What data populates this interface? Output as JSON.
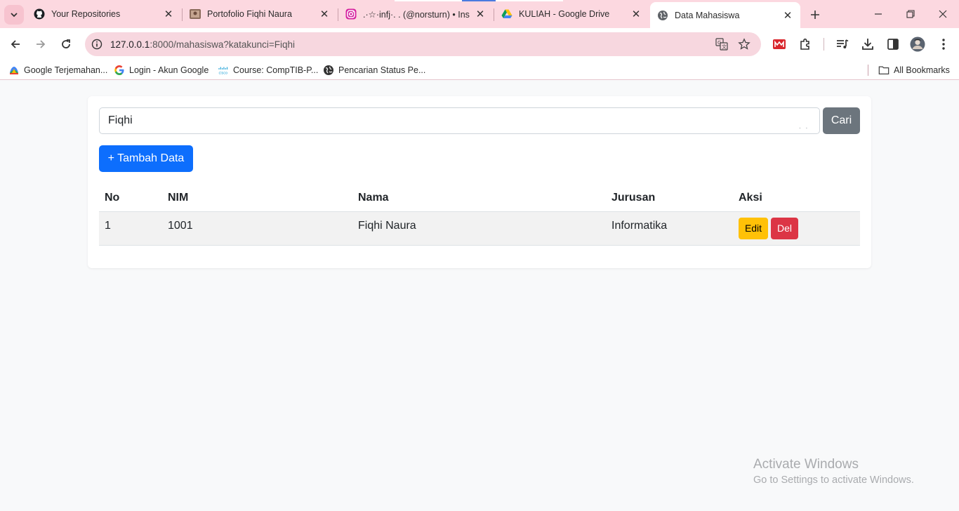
{
  "browser": {
    "tabs": [
      {
        "title": "Your Repositories",
        "icon": "github-icon"
      },
      {
        "title": "Portofolio Fiqhi Naura",
        "icon": "photo-favicon-icon"
      },
      {
        "title": ".·☆·infj·. . (@norsturn) • Ins",
        "icon": "instagram-icon"
      },
      {
        "title": "KULIAH - Google Drive",
        "icon": "google-drive-icon"
      },
      {
        "title": "Data Mahasiswa",
        "icon": "globe-icon",
        "active": true
      }
    ],
    "url_host": "127.0.0.1",
    "url_rest": ":8000/mahasiswa?katakunci=Fiqhi",
    "bookmarks": [
      {
        "label": "Google Terjemahan...",
        "icon": "translate-favicon-icon"
      },
      {
        "label": "Login - Akun Google",
        "icon": "google-icon"
      },
      {
        "label": "Course: CompTIB-P...",
        "icon": "cisco-icon"
      },
      {
        "label": "Pencarian Status Pe...",
        "icon": "globe-icon"
      }
    ],
    "all_bookmarks": "All Bookmarks",
    "colors": {
      "frame": "#fcd8e0",
      "omnibox": "#f7d7df"
    }
  },
  "page": {
    "search": {
      "value": "Fiqhi",
      "button_label": "Cari",
      "dots": ". ."
    },
    "add_button_label": "+ Tambah Data",
    "table": {
      "headers": [
        "No",
        "NIM",
        "Nama",
        "Jurusan",
        "Aksi"
      ],
      "rows": [
        {
          "no": "1",
          "nim": "1001",
          "nama": "Fiqhi Naura",
          "jurusan": "Informatika",
          "edit_label": "Edit",
          "del_label": "Del"
        }
      ]
    },
    "colors": {
      "primary": "#0d6efd",
      "secondary": "#6c757d",
      "warning": "#ffc107",
      "danger": "#dc3545"
    }
  },
  "watermark": {
    "line1": "Activate Windows",
    "line2": "Go to Settings to activate Windows."
  }
}
